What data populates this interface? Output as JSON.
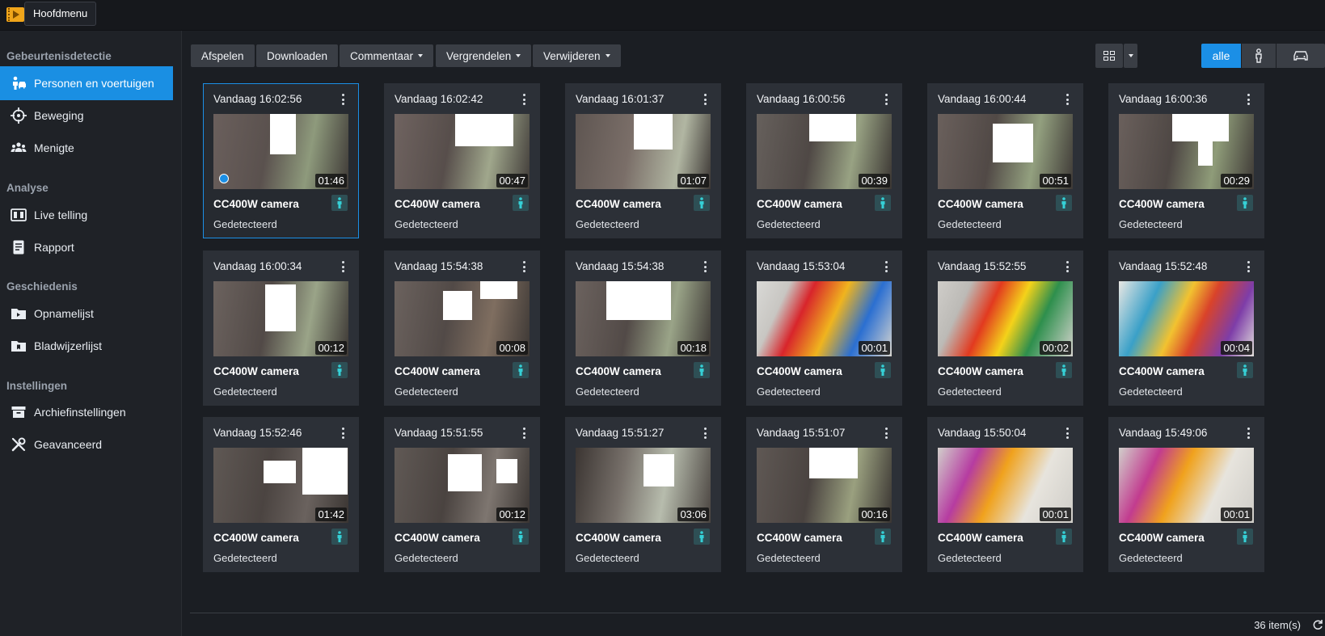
{
  "topbar": {
    "menu_label": "Hoofdmenu"
  },
  "sidebar": {
    "sections": [
      {
        "title": "Gebeurtenisdetectie"
      },
      {
        "title": "Analyse"
      },
      {
        "title": "Geschiedenis"
      },
      {
        "title": "Instellingen"
      }
    ],
    "items": [
      {
        "label": "Personen en voertuigen",
        "icon": "person-car-icon",
        "active": true
      },
      {
        "label": "Beweging",
        "icon": "crosshair-icon"
      },
      {
        "label": "Menigte",
        "icon": "group-icon"
      },
      {
        "label": "Live telling",
        "icon": "counter-icon"
      },
      {
        "label": "Rapport",
        "icon": "report-icon"
      },
      {
        "label": "Opnamelijst",
        "icon": "folder-video-icon"
      },
      {
        "label": "Bladwijzerlijst",
        "icon": "folder-bookmark-icon"
      },
      {
        "label": "Archiefinstellingen",
        "icon": "archive-icon"
      },
      {
        "label": "Geavanceerd",
        "icon": "tools-icon"
      }
    ]
  },
  "toolbar": {
    "play": "Afspelen",
    "download": "Downloaden",
    "comment": "Commentaar",
    "lock": "Vergrendelen",
    "delete": "Verwijderen",
    "filter_all": "alle"
  },
  "accent_color": "#1b8fe6",
  "cards": [
    {
      "time": "Vandaag 16:02:56",
      "duration": "01:46",
      "camera": "CC400W camera",
      "status": "Gedetecteerd"
    },
    {
      "time": "Vandaag 16:02:42",
      "duration": "00:47",
      "camera": "CC400W camera",
      "status": "Gedetecteerd"
    },
    {
      "time": "Vandaag 16:01:37",
      "duration": "01:07",
      "camera": "CC400W camera",
      "status": "Gedetecteerd"
    },
    {
      "time": "Vandaag 16:00:56",
      "duration": "00:39",
      "camera": "CC400W camera",
      "status": "Gedetecteerd"
    },
    {
      "time": "Vandaag 16:00:44",
      "duration": "00:51",
      "camera": "CC400W camera",
      "status": "Gedetecteerd"
    },
    {
      "time": "Vandaag 16:00:36",
      "duration": "00:29",
      "camera": "CC400W camera",
      "status": "Gedetecteerd"
    },
    {
      "time": "Vandaag 16:00:34",
      "duration": "00:12",
      "camera": "CC400W camera",
      "status": "Gedetecteerd"
    },
    {
      "time": "Vandaag 15:54:38",
      "duration": "00:08",
      "camera": "CC400W camera",
      "status": "Gedetecteerd"
    },
    {
      "time": "Vandaag 15:54:38",
      "duration": "00:18",
      "camera": "CC400W camera",
      "status": "Gedetecteerd"
    },
    {
      "time": "Vandaag 15:53:04",
      "duration": "00:01",
      "camera": "CC400W camera",
      "status": "Gedetecteerd"
    },
    {
      "time": "Vandaag 15:52:55",
      "duration": "00:02",
      "camera": "CC400W camera",
      "status": "Gedetecteerd"
    },
    {
      "time": "Vandaag 15:52:48",
      "duration": "00:04",
      "camera": "CC400W camera",
      "status": "Gedetecteerd"
    },
    {
      "time": "Vandaag 15:52:46",
      "duration": "01:42",
      "camera": "CC400W camera",
      "status": "Gedetecteerd"
    },
    {
      "time": "Vandaag 15:51:55",
      "duration": "00:12",
      "camera": "CC400W camera",
      "status": "Gedetecteerd"
    },
    {
      "time": "Vandaag 15:51:27",
      "duration": "03:06",
      "camera": "CC400W camera",
      "status": "Gedetecteerd"
    },
    {
      "time": "Vandaag 15:51:07",
      "duration": "00:16",
      "camera": "CC400W camera",
      "status": "Gedetecteerd"
    },
    {
      "time": "Vandaag 15:50:04",
      "duration": "00:01",
      "camera": "CC400W camera",
      "status": "Gedetecteerd"
    },
    {
      "time": "Vandaag 15:49:06",
      "duration": "00:01",
      "camera": "CC400W camera",
      "status": "Gedetecteerd"
    }
  ],
  "footer": {
    "count": "36 item(s)"
  }
}
